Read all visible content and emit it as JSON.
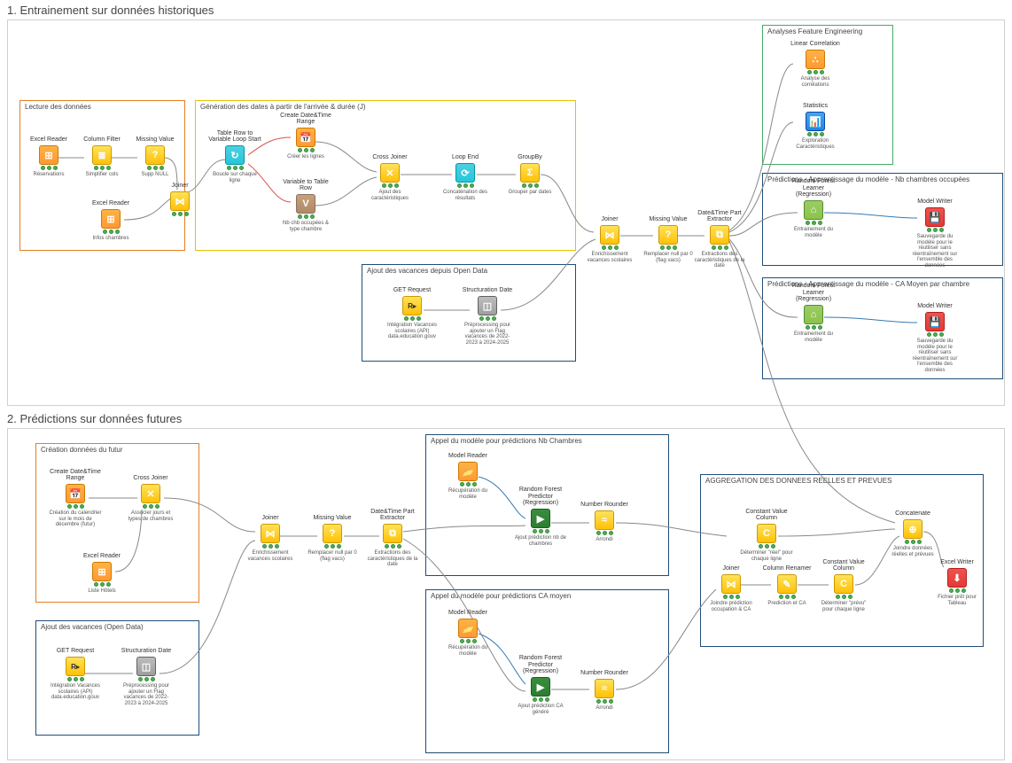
{
  "section1": {
    "title": "1. Entrainement sur données historiques",
    "groups": {
      "lecture": {
        "title": "Lecture des données"
      },
      "gendates": {
        "title": "Génération des dates à partir de l'arrivée & durée (J)"
      },
      "ajoutvac": {
        "title": "Ajout des vacances depuis Open Data"
      },
      "analyses": {
        "title": "Analyses Feature Engineering"
      },
      "pred_nb": {
        "title": "Prédictions - Apprentissage du modèle - Nb chambres occupées"
      },
      "pred_ca": {
        "title": "Prédictions - Apprentissage du modèle - CA Moyen par chambre"
      }
    },
    "nodes": {
      "excel1": {
        "title": "Excel Reader",
        "caption": "Réservations"
      },
      "colfilter": {
        "title": "Column Filter",
        "caption": "Simplifier cols"
      },
      "missval1": {
        "title": "Missing Value",
        "caption": "Supp NULL"
      },
      "joiner1": {
        "title": "Joiner",
        "caption": ""
      },
      "excel2": {
        "title": "Excel Reader",
        "caption": "Infos chambres"
      },
      "loopstart": {
        "title": "Table Row to Variable Loop Start",
        "caption": "Boucle sur chaque ligne"
      },
      "createdt": {
        "title": "Create Date&Time Range",
        "caption": "Créer les lignes"
      },
      "var2row": {
        "title": "Variable to Table Row",
        "caption": "Nb chb occupées & type chambre"
      },
      "crossj": {
        "title": "Cross Joiner",
        "caption": "Ajout des caractéristiques"
      },
      "loopend": {
        "title": "Loop End",
        "caption": "Concaténation des résultats"
      },
      "groupby": {
        "title": "GroupBy",
        "caption": "Grouper par dates"
      },
      "getreq1": {
        "title": "GET Request",
        "caption": "Intégration Vacances scolaires (API) data.education.gouv"
      },
      "structdate1": {
        "title": "Structuration Date",
        "caption": "Préprocessing pour ajouter un Flag vacances de 2022-2023 à 2024-2025"
      },
      "joiner2": {
        "title": "Joiner",
        "caption": "Enrichissement vacances scolaires"
      },
      "missval2": {
        "title": "Missing Value",
        "caption": "Remplacer null par 0 (flag vacs)"
      },
      "dtextract": {
        "title": "Date&Time Part Extractor",
        "caption": "Extractions des caractéristiques de la date"
      },
      "lincorr": {
        "title": "Linear Correlation",
        "caption": "Analyse des corrélations"
      },
      "stats": {
        "title": "Statistics",
        "caption": "Exploration Caractéristiques"
      },
      "rf1": {
        "title": "Random Forest Learner (Regression)",
        "caption": "Entrainement du modèle"
      },
      "mw1": {
        "title": "Model Writer",
        "caption": "Sauvegarde du modèle pour le réutiliser sans réentraînement sur l'ensemble des données"
      },
      "rf2": {
        "title": "Random Forest Learner (Regression)",
        "caption": "Entrainement du modèle"
      },
      "mw2": {
        "title": "Model Writer",
        "caption": "Sauvegarde du modèle pour le réutiliser sans réentraînement sur l'ensemble des données"
      }
    }
  },
  "section2": {
    "title": "2. Prédictions sur données futures",
    "groups": {
      "creation": {
        "title": "Création données du futur"
      },
      "ajoutvac2": {
        "title": "Ajout des vacances (Open Data)"
      },
      "appel_nb": {
        "title": "Appel du modèle pour prédictions Nb Chambres"
      },
      "appel_ca": {
        "title": "Appel du modèle pour prédictions CA moyen"
      },
      "aggreg": {
        "title": "AGGREGATION DES DONNEES REELLES ET PREVUES"
      }
    },
    "nodes": {
      "createdt2": {
        "title": "Create Date&Time Range",
        "caption": "Création du calendrier sur le mois de décembre (futur)"
      },
      "crossj2": {
        "title": "Cross Joiner",
        "caption": "Associer jours et types de chambres"
      },
      "excel3": {
        "title": "Excel Reader",
        "caption": "Liste Hôtels"
      },
      "getreq2": {
        "title": "GET Request",
        "caption": "Intégration Vacances scolaires (API) data.education.gouv"
      },
      "structdate2": {
        "title": "Structuration Date",
        "caption": "Préprocessing pour ajouter un Flag vacances de 2022-2023 à 2024-2025"
      },
      "joiner3": {
        "title": "Joiner",
        "caption": "Enrichissement vacances scolaires"
      },
      "missval3": {
        "title": "Missing Value",
        "caption": "Remplacer null par 0 (flag vacs)"
      },
      "dtextract2": {
        "title": "Date&Time Part Extractor",
        "caption": "Extractions des caractéristiques de la date"
      },
      "mr1": {
        "title": "Model Reader",
        "caption": "Récupération du modèle"
      },
      "rfp1": {
        "title": "Random Forest Predictor (Regression)",
        "caption": "Ajout prédiction nb de chambres"
      },
      "round1": {
        "title": "Number Rounder",
        "caption": "Arrondi"
      },
      "mr2": {
        "title": "Model Reader",
        "caption": "Récupération du modèle"
      },
      "rfp2": {
        "title": "Random Forest Predictor (Regression)",
        "caption": "Ajout prédiction CA généré"
      },
      "round2": {
        "title": "Number Rounder",
        "caption": "Arrondi"
      },
      "cvc1": {
        "title": "Constant Value Column",
        "caption": "Déterminer \"réel\" pour chaque ligne"
      },
      "joiner4": {
        "title": "Joiner",
        "caption": "Joindre prédiction occupation & CA"
      },
      "colren": {
        "title": "Column Renamer",
        "caption": "Prediction et CA"
      },
      "cvc2": {
        "title": "Constant Value Column",
        "caption": "Déterminer \"prévu\" pour chaque ligne"
      },
      "concat": {
        "title": "Concatenate",
        "caption": "Joindre données réelles et prévues"
      },
      "excelw": {
        "title": "Excel Writer",
        "caption": "Fichier prêt pour Tableau"
      }
    }
  }
}
